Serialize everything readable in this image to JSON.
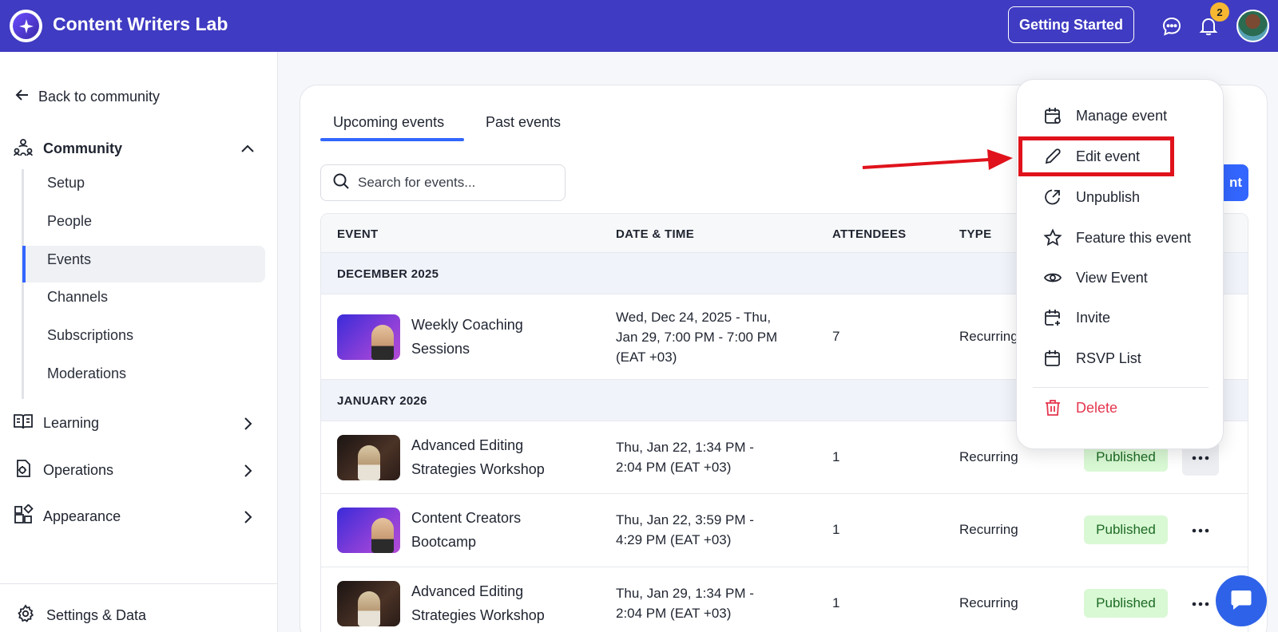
{
  "header": {
    "app_title": "Content Writers Lab",
    "getting_started_label": "Getting Started",
    "notification_count": "2"
  },
  "sidebar": {
    "back_label": "Back to community",
    "community": {
      "label": "Community",
      "items": [
        "Setup",
        "People",
        "Events",
        "Channels",
        "Subscriptions",
        "Moderations"
      ],
      "active": "Events"
    },
    "sections": [
      "Learning",
      "Operations",
      "Appearance"
    ],
    "settings_label": "Settings & Data"
  },
  "main": {
    "tabs": [
      "Upcoming events",
      "Past events"
    ],
    "active_tab": "Upcoming events",
    "search_placeholder": "Search for events...",
    "create_button_partial": "nt",
    "columns": [
      "EVENT",
      "DATE & TIME",
      "ATTENDEES",
      "TYPE"
    ],
    "groups": [
      {
        "label": "DECEMBER 2025",
        "rows": [
          {
            "title_line1": "Weekly Coaching",
            "title_line2": "Sessions",
            "date_line1": "Wed, Dec 24, 2025 - Thu,",
            "date_line2": "Jan 29, 7:00 PM - 7:00 PM",
            "date_line3": "(EAT +03)",
            "attendees": "7",
            "type": "Recurring"
          }
        ]
      },
      {
        "label": "JANUARY 2026",
        "rows": [
          {
            "title_line1": "Advanced Editing",
            "title_line2": "Strategies Workshop",
            "date_line1": "Thu, Jan 22, 1:34 PM -",
            "date_line2": "2:04 PM (EAT +03)",
            "attendees": "1",
            "type": "Recurring",
            "status": "Published"
          },
          {
            "title_line1": "Content Creators",
            "title_line2": "Bootcamp",
            "date_line1": "Thu, Jan 22, 3:59 PM -",
            "date_line2": "4:29 PM (EAT +03)",
            "attendees": "1",
            "type": "Recurring",
            "status": "Published"
          },
          {
            "title_line1": "Advanced Editing",
            "title_line2": "Strategies Workshop",
            "date_line1": "Thu, Jan 29, 1:34 PM -",
            "date_line2": "2:04 PM (EAT +03)",
            "attendees": "1",
            "type": "Recurring",
            "status": "Published"
          }
        ]
      }
    ]
  },
  "menu": {
    "items": [
      "Manage event",
      "Edit event",
      "Unpublish",
      "Feature this event",
      "View Event",
      "Invite",
      "RSVP List"
    ],
    "delete_label": "Delete",
    "highlighted": "Edit event"
  },
  "colors": {
    "brand": "#3f3bc2",
    "accent": "#3366ff",
    "published_bg": "#d9f8d4",
    "danger": "#e5364f",
    "annotation": "#e0121b"
  }
}
